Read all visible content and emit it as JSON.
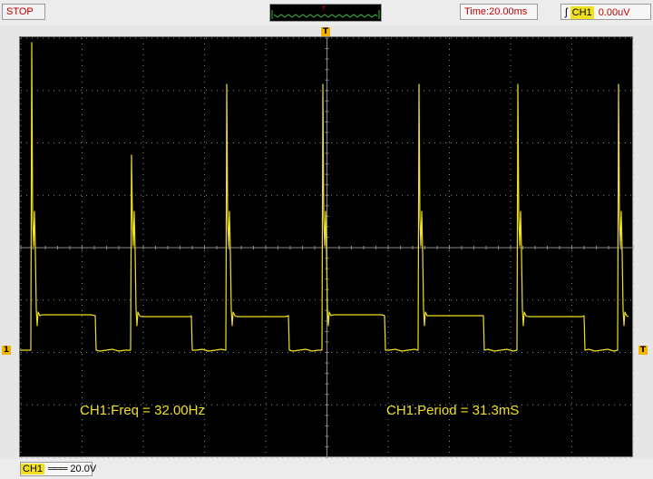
{
  "status": {
    "run_state": "STOP"
  },
  "timebase": {
    "label": "Time:20.00ms"
  },
  "trigger": {
    "edge_glyph": "ʃ",
    "channel": "CH1",
    "level": "0.00uV"
  },
  "markers": {
    "trigger_position": "T",
    "channel1_ground": "1",
    "trigger_level": "T"
  },
  "measurements": {
    "frequency": "CH1:Freq = 32.00Hz",
    "period": "CH1:Period = 31.3mS"
  },
  "channel_info": {
    "channel": "CH1",
    "coupling_glyph": "═══",
    "volts_div": "20.0V"
  },
  "colors": {
    "trace": "#f0e020",
    "grid": "#8a8a8a",
    "screen_bg": "#000000",
    "marker": "#f0b400",
    "stop_text": "#c00000"
  }
}
